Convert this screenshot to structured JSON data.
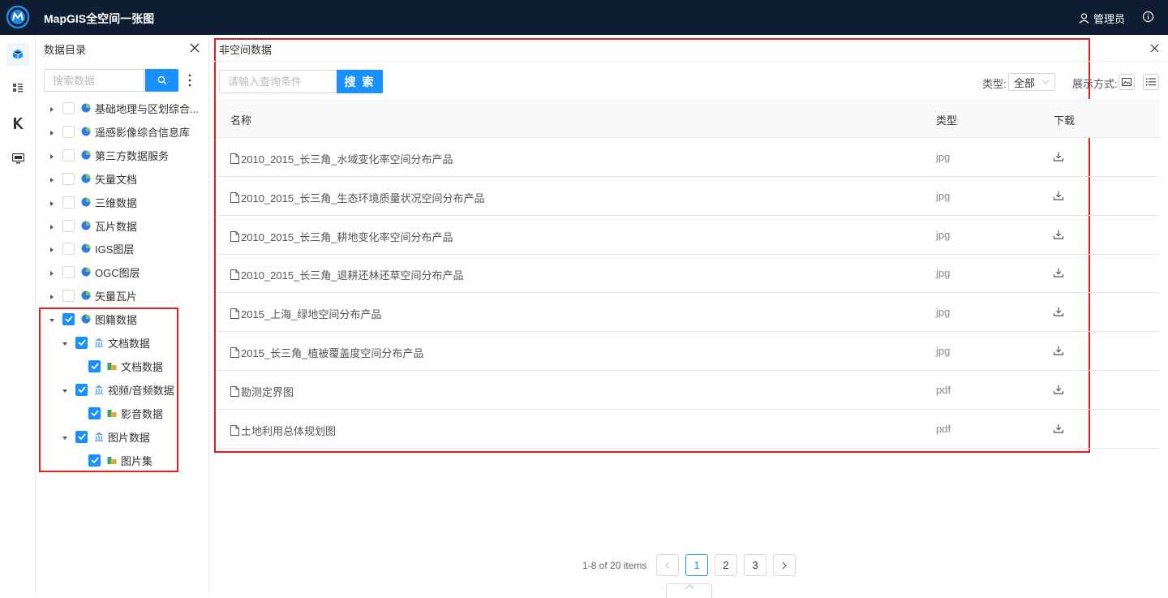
{
  "header": {
    "app_title": "MapGIS全空间一张图",
    "user_name": "管理员"
  },
  "catalog": {
    "title": "数据目录",
    "search_placeholder": "搜索数据",
    "tree": [
      {
        "label": "基础地理与区划综合...",
        "checked": false,
        "expanded": false,
        "level": 0
      },
      {
        "label": "遥感影像综合信息库",
        "checked": false,
        "expanded": false,
        "level": 0
      },
      {
        "label": "第三方数据服务",
        "checked": false,
        "expanded": false,
        "level": 0
      },
      {
        "label": "矢量文档",
        "checked": false,
        "expanded": false,
        "level": 0
      },
      {
        "label": "三维数据",
        "checked": false,
        "expanded": false,
        "level": 0
      },
      {
        "label": "瓦片数据",
        "checked": false,
        "expanded": false,
        "level": 0
      },
      {
        "label": "IGS图层",
        "checked": false,
        "expanded": false,
        "level": 0
      },
      {
        "label": "OGC图层",
        "checked": false,
        "expanded": false,
        "level": 0
      },
      {
        "label": "矢量瓦片",
        "checked": false,
        "expanded": false,
        "level": 0
      },
      {
        "label": "图籍数据",
        "checked": true,
        "expanded": true,
        "level": 0
      },
      {
        "label": "文档数据",
        "checked": true,
        "expanded": true,
        "level": 1
      },
      {
        "label": "文档数据",
        "checked": true,
        "expanded": false,
        "level": 2
      },
      {
        "label": "视频/音频数据",
        "checked": true,
        "expanded": true,
        "level": 1
      },
      {
        "label": "影音数据",
        "checked": true,
        "expanded": false,
        "level": 2
      },
      {
        "label": "图片数据",
        "checked": true,
        "expanded": true,
        "level": 1
      },
      {
        "label": "图片集",
        "checked": true,
        "expanded": false,
        "level": 2
      }
    ]
  },
  "panel": {
    "title": "非空间数据",
    "query_placeholder": "请输入查询条件",
    "search_label": "搜 索",
    "type_label": "类型:",
    "type_value": "全部",
    "display_label": "展示方式:",
    "columns": {
      "name": "名称",
      "type": "类型",
      "download": "下载"
    },
    "rows": [
      {
        "name": "2010_2015_长三角_水域变化率空间分布产品",
        "type": "jpg"
      },
      {
        "name": "2010_2015_长三角_生态环境质量状况空间分布产品",
        "type": "jpg"
      },
      {
        "name": "2010_2015_长三角_耕地变化率空间分布产品",
        "type": "jpg"
      },
      {
        "name": "2010_2015_长三角_退耕还林还草空间分布产品",
        "type": "jpg"
      },
      {
        "name": "2015_上海_绿地空间分布产品",
        "type": "jpg"
      },
      {
        "name": "2015_长三角_植被覆盖度空间分布产品",
        "type": "jpg"
      },
      {
        "name": "勘测定界图",
        "type": "pdf"
      },
      {
        "name": "土地利用总体规划图",
        "type": "pdf"
      }
    ]
  },
  "pagination": {
    "total_text": "1-8 of 20 items",
    "pages": [
      "1",
      "2",
      "3"
    ],
    "current": "1"
  },
  "colors": {
    "topbar": "#0f1d33",
    "primary": "#1890ff",
    "highlight_box": "#e02020"
  }
}
